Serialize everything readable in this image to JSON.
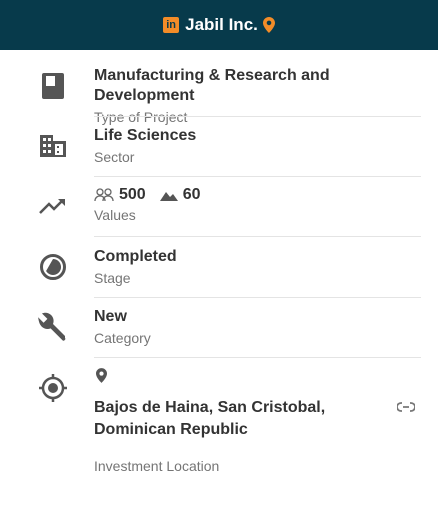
{
  "header": {
    "linkedin_icon": "linkedin-icon",
    "title": "Jabil Inc.",
    "location_icon": "map-pin-icon",
    "accent": "#f28c28",
    "background": "#073a4b"
  },
  "rows": {
    "project_type": {
      "icon": "book-icon",
      "value": "Manufacturing & Research and Development",
      "label": "Type of Project"
    },
    "sector": {
      "icon": "building-icon",
      "value": "Life Sciences",
      "label": "Sector"
    },
    "values": {
      "icon": "trending-up-icon",
      "people_icon": "people-icon",
      "people": "500",
      "landscape_icon": "landscape-icon",
      "landscape": "60",
      "label": "Values"
    },
    "stage": {
      "icon": "stage-pie-icon",
      "value": "Completed",
      "label": "Stage"
    },
    "category": {
      "icon": "wrench-icon",
      "value": "New",
      "label": "Category"
    },
    "location": {
      "icon": "target-location-icon",
      "pin_icon": "map-pin-icon",
      "value": "Bajos de Haina, San Cristobal, Dominican Republic",
      "link_icon": "link-icon",
      "label": "Investment Location"
    }
  }
}
